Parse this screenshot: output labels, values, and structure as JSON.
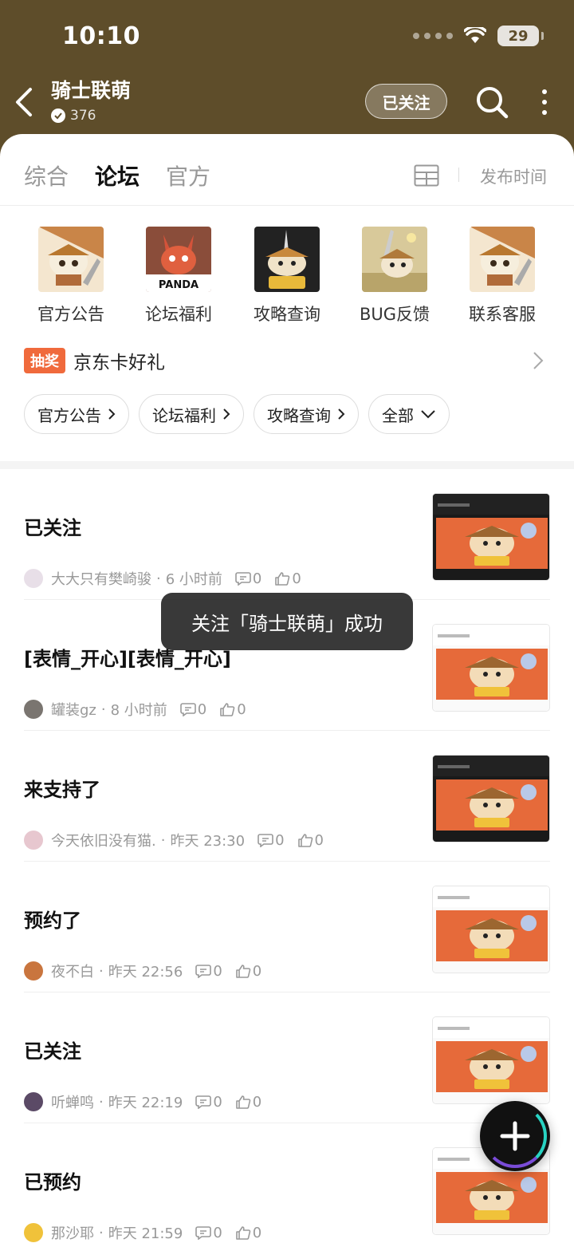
{
  "status_bar": {
    "time": "10:10",
    "battery": "29"
  },
  "header": {
    "title": "骑士联萌",
    "fans_count": "376",
    "follow_label": "已关注"
  },
  "tabs": [
    {
      "label": "综合",
      "active": false
    },
    {
      "label": "论坛",
      "active": true
    },
    {
      "label": "官方",
      "active": false
    }
  ],
  "sort_label": "发布时间",
  "categories": [
    {
      "label": "官方公告"
    },
    {
      "label": "论坛福利"
    },
    {
      "label": "攻略查询"
    },
    {
      "label": "BUG反馈"
    },
    {
      "label": "联系客服"
    }
  ],
  "category_thumbs": [
    "PANDA"
  ],
  "lottery": {
    "badge": "抽奖",
    "text": "京东卡好礼"
  },
  "filters": [
    {
      "label": "官方公告"
    },
    {
      "label": "论坛福利"
    },
    {
      "label": "攻略查询"
    },
    {
      "label": "全部"
    }
  ],
  "posts": [
    {
      "title": "已关注",
      "author": "大大只有樊崎骏",
      "time": "6 小时前",
      "comments": "0",
      "likes": "0",
      "avatar_color": "#e8dfe8"
    },
    {
      "title": "[表情_开心][表情_开心]",
      "author": "罐装gz",
      "time": "8 小时前",
      "comments": "0",
      "likes": "0",
      "avatar_color": "#7a7570"
    },
    {
      "title": "来支持了",
      "author": "今天依旧没有猫.",
      "time": "昨天 23:30",
      "comments": "0",
      "likes": "0",
      "avatar_color": "#e7c7cf"
    },
    {
      "title": "预约了",
      "author": "夜不白",
      "time": "昨天 22:56",
      "comments": "0",
      "likes": "0",
      "avatar_color": "#c9753e"
    },
    {
      "title": "已关注",
      "author": "听蝉鸣",
      "time": "昨天 22:19",
      "comments": "0",
      "likes": "0",
      "avatar_color": "#5b4a66"
    },
    {
      "title": "已预约",
      "author": "那沙耶",
      "time": "昨天 21:59",
      "comments": "0",
      "likes": "0",
      "avatar_color": "#f0c23a"
    }
  ],
  "toast": "关注「骑士联萌」成功",
  "colors": {
    "header_bg": "#5e4d2a",
    "accent": "#48d1b0",
    "lottery_badge": "#f06a3c"
  }
}
